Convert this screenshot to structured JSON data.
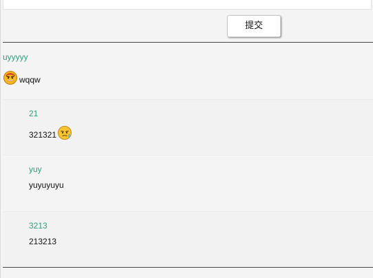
{
  "form": {
    "submit_label": "提交"
  },
  "comments": [
    {
      "user": "uyyyyy",
      "text": "wqqw",
      "emoji": "angry-face-icon",
      "replies": [
        {
          "user": "21",
          "text": "321321",
          "emoji": "sweating-face-icon"
        },
        {
          "user": "yuy",
          "text": "yuyuyuyu"
        },
        {
          "user": "3213",
          "text": "213213"
        }
      ]
    }
  ],
  "colors": {
    "username": "#2aa080",
    "text": "#111111",
    "background": "#f4f4f4"
  }
}
